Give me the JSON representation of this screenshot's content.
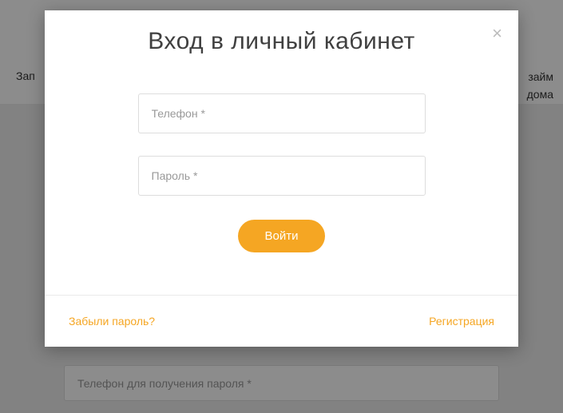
{
  "background": {
    "left_text": "Зап",
    "right_text_line1": "займ",
    "right_text_line2": "дома",
    "bottom_input_placeholder": "Телефон для получения пароля *"
  },
  "modal": {
    "title": "Вход в личный кабинет",
    "close_glyph": "×",
    "phone_placeholder": "Телефон *",
    "password_placeholder": "Пароль *",
    "login_button_label": "Войти",
    "forgot_password_label": "Забыли пароль?",
    "register_label": "Регистрация"
  }
}
